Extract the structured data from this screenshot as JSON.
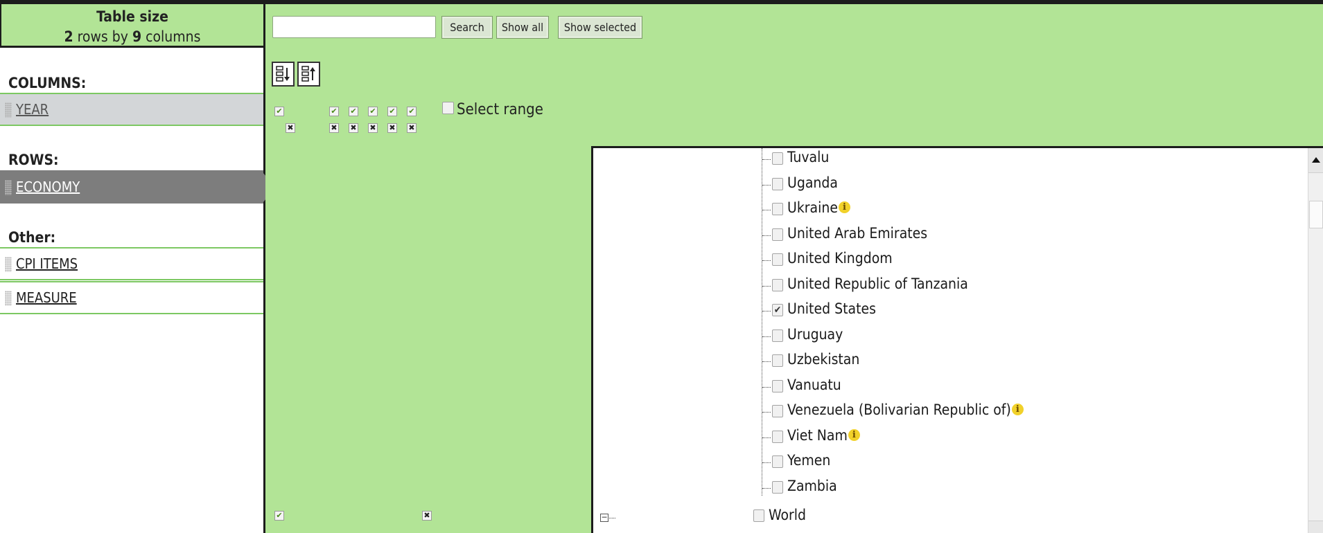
{
  "table_size": {
    "title": "Table size",
    "rows_count": "2",
    "rows_word": "rows by",
    "cols_count": "9",
    "cols_word": "columns"
  },
  "layout_panel": {
    "columns_label": "COLUMNS:",
    "columns": [
      {
        "label": "YEAR"
      }
    ],
    "rows_label": "ROWS:",
    "rows": [
      {
        "label": "ECONOMY",
        "selected": true
      }
    ],
    "other_label": "Other:",
    "other": [
      {
        "label": "CPI ITEMS"
      },
      {
        "label": "MEASURE"
      }
    ]
  },
  "toolbar": {
    "search_placeholder": "",
    "search_value": "",
    "search_label": "Search",
    "show_all_label": "Show all",
    "show_selected_label": "Show selected"
  },
  "select_range_label": "Select range",
  "tree": {
    "items": [
      {
        "name": "Tuvalu",
        "checked": false,
        "info": false
      },
      {
        "name": "Uganda",
        "checked": false,
        "info": false
      },
      {
        "name": "Ukraine",
        "checked": false,
        "info": true
      },
      {
        "name": "United Arab Emirates",
        "checked": false,
        "info": false
      },
      {
        "name": "United Kingdom",
        "checked": false,
        "info": false
      },
      {
        "name": "United Republic of Tanzania",
        "checked": false,
        "info": false
      },
      {
        "name": "United States",
        "checked": true,
        "info": false
      },
      {
        "name": "Uruguay",
        "checked": false,
        "info": false
      },
      {
        "name": "Uzbekistan",
        "checked": false,
        "info": false
      },
      {
        "name": "Vanuatu",
        "checked": false,
        "info": false
      },
      {
        "name": "Venezuela (Bolivarian Republic of)",
        "checked": false,
        "info": true
      },
      {
        "name": "Viet Nam",
        "checked": false,
        "info": true
      },
      {
        "name": "Yemen",
        "checked": false,
        "info": false
      },
      {
        "name": "Zambia",
        "checked": false,
        "info": false
      }
    ],
    "root": {
      "name": "World",
      "checked": false
    }
  },
  "icons": {
    "check": "✔",
    "cross": "✖",
    "info": "i",
    "collapse": "−"
  }
}
